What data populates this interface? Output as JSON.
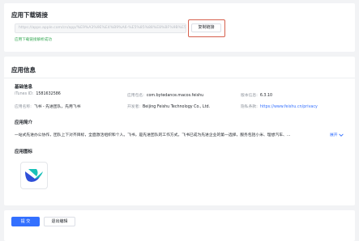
{
  "download": {
    "title": "应用下载链接",
    "link": "https://apps.apple.com/cn/app/%E9%A3%9E%E4%B9%A6-%E5%85%88%E8%BF%9B%E5%9B%A2%E9%98%9F-%E5%85%88%E7%94%A8%E9%A3%9E%E4%B9%A6/id1519832586",
    "copy_button": "复制链接",
    "success_message": "应用下载链接解析成功"
  },
  "app_info": {
    "title": "应用信息",
    "basic_label": "基础信息",
    "fields": {
      "itunes_id": {
        "label": "iTunes ID:",
        "value": "1581632586"
      },
      "bundle_id": {
        "label": "应用包名:",
        "value": "com.bytedance.macos.feishu"
      },
      "version": {
        "label": "版本信息:",
        "value": "6.3.10"
      },
      "app_name": {
        "label": "应用名称:",
        "value": "飞书 - 先进团队，先用飞书"
      },
      "developer": {
        "label": "开发者:",
        "value": "Beijing Feishu Technology Co., Ltd."
      },
      "privacy": {
        "label": "隐私条款:",
        "value": "https://www.feishu.cn/privacy"
      }
    },
    "intro_label": "应用简介",
    "intro_text": "一站式先进办公协作，团队上下对齐目标，全面激活组织和个人。飞书，是先进团队的工作方式。飞书已成为先进企业的第一选择，服务包括小米、理想汽车、...",
    "expand_label": "展开",
    "icon_label": "应用图标"
  },
  "footer": {
    "submit": "提 交",
    "exit": "退出编辑"
  },
  "colors": {
    "primary": "#3370ff",
    "success": "#34a853",
    "highlight": "#d6604d",
    "icon_dark": "#2f4fd8",
    "icon_light": "#18c0b8"
  }
}
